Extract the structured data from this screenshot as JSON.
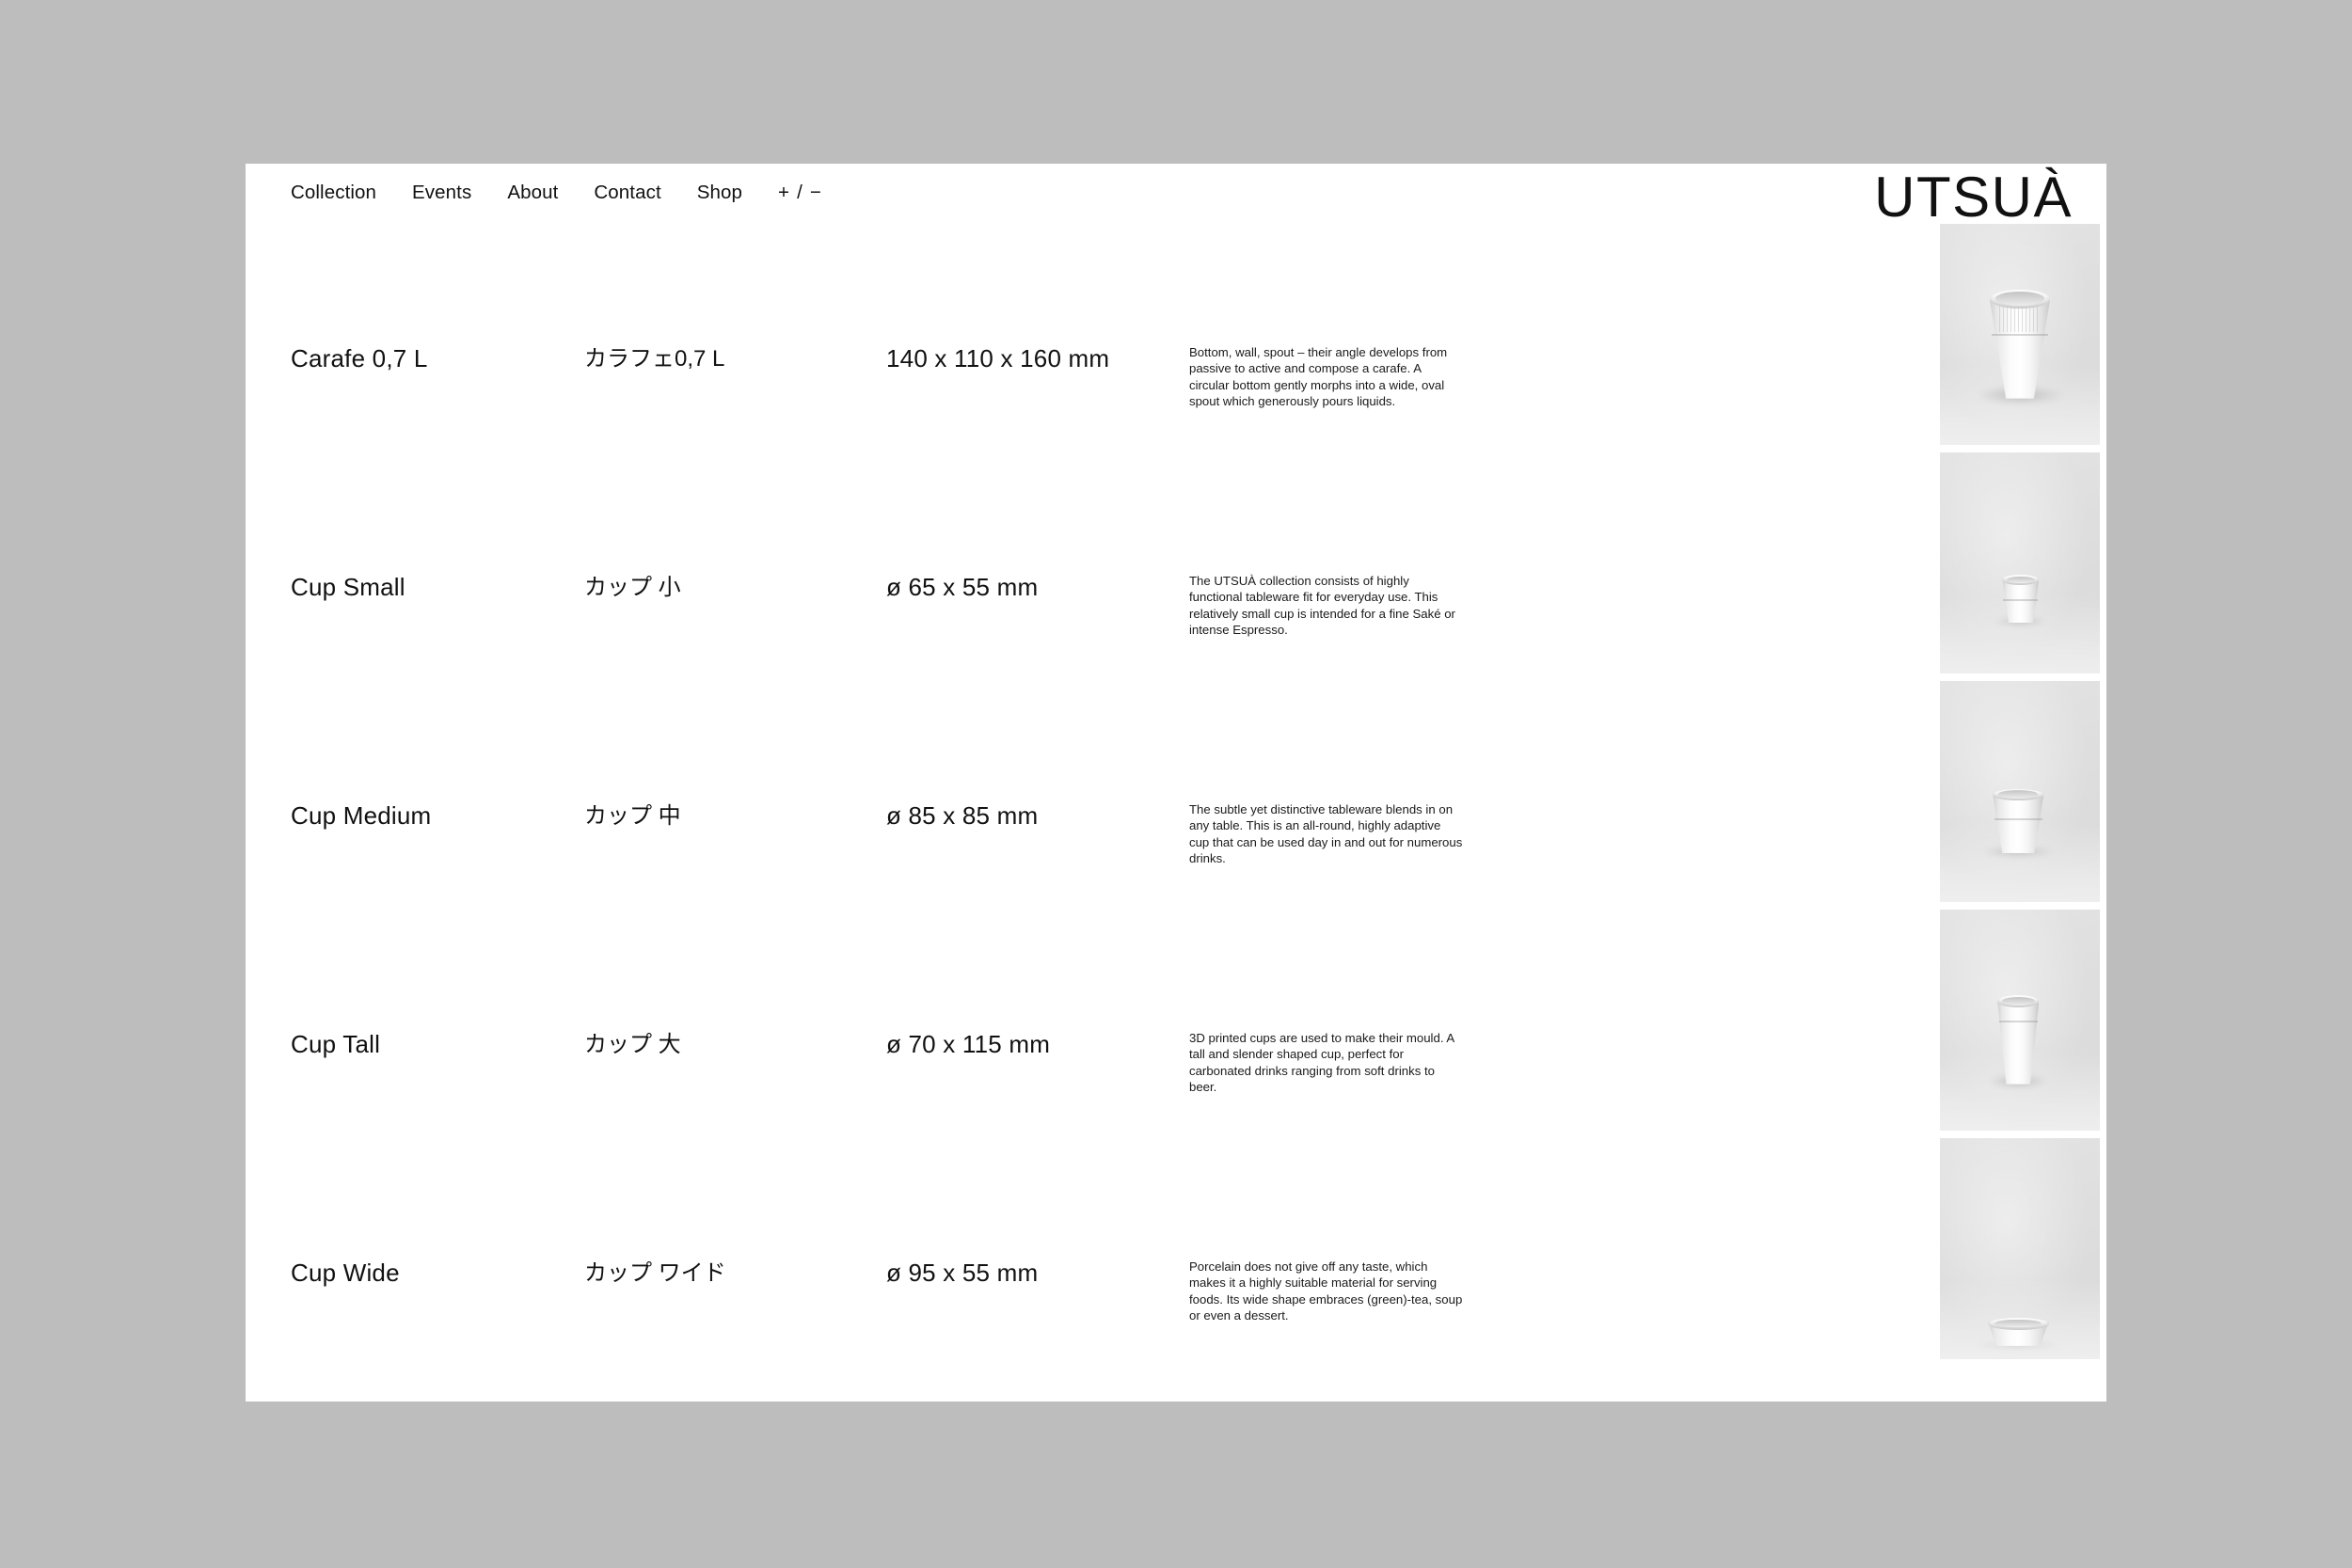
{
  "header": {
    "nav": [
      {
        "label": "Collection"
      },
      {
        "label": "Events"
      },
      {
        "label": "About"
      },
      {
        "label": "Contact"
      },
      {
        "label": "Shop"
      }
    ],
    "size_toggle": "+ / −",
    "brand": "UTSUÀ"
  },
  "colors": {
    "page_background": "#bdbdbd",
    "content_background": "#ffffff",
    "text": "#111111",
    "thumbnail_background": "#dedede"
  },
  "products": [
    {
      "name": "Carafe 0,7 L",
      "name_jp": "カラフェ0,7 L",
      "dimensions": "140 x 110 x 160 mm",
      "description": "Bottom, wall, spout – their angle develops from passive to active and compose a carafe. A circular bottom gently morphs into a wide, oval spout which generously pours liquids.",
      "image_alt": "white porcelain carafe with fluted upper body"
    },
    {
      "name": "Cup Small",
      "name_jp": "カップ 小",
      "dimensions": "ø 65 x 55 mm",
      "description": "The UTSUÀ collection consists of highly functional tableware fit for everyday use. This relatively small cup is intended for a fine Saké or intense Espresso.",
      "image_alt": "small white porcelain cup"
    },
    {
      "name": "Cup Medium",
      "name_jp": "カップ 中",
      "dimensions": "ø 85 x 85 mm",
      "description": "The subtle yet distinctive tableware blends in on any table. This is an all-round, highly adaptive cup that can be used day in and out for numerous drinks.",
      "image_alt": "medium white porcelain cup"
    },
    {
      "name": "Cup Tall",
      "name_jp": "カップ 大",
      "dimensions": "ø 70 x 115 mm",
      "description": "3D printed cups are used to make their mould. A tall and slender shaped cup, perfect for carbonated drinks ranging from soft drinks to beer.",
      "image_alt": "tall slender white porcelain cup"
    },
    {
      "name": "Cup Wide",
      "name_jp": "カップ ワイド",
      "dimensions": "ø 95 x 55 mm",
      "description": "Porcelain does not give off any taste, which makes it a highly suitable material for serving foods. Its wide shape embraces (green)-tea, soup or even a dessert.",
      "image_alt": "wide shallow white porcelain cup"
    }
  ]
}
